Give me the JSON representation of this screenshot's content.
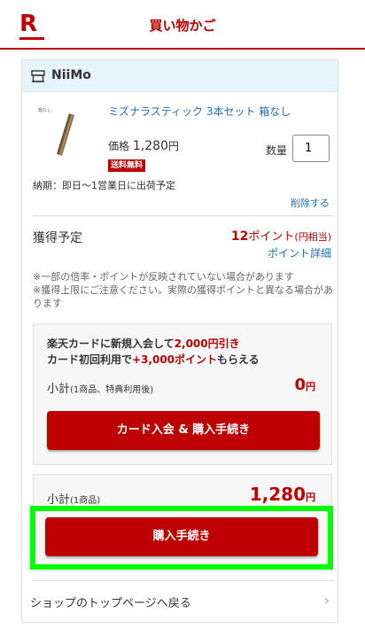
{
  "header": {
    "logo_letter": "R",
    "title": "買い物かご",
    "brand_color": "#bf0000"
  },
  "shop": {
    "icon": "shop-icon",
    "name": "NiiMo"
  },
  "item": {
    "image_caption": "箱なし",
    "name": "ミズナラスティック 3本セット 箱なし",
    "price_label": "価格",
    "price": "1,280",
    "price_unit": "円",
    "free_shipping": "送料無料",
    "quantity_label": "数量",
    "quantity": "1",
    "delivery": "納期：即日〜1営業日に出荷予定",
    "delete": "削除する"
  },
  "points": {
    "label": "獲得予定",
    "value": "12",
    "unit": "ポイント",
    "note": "(円相当)",
    "detail_link": "ポイント詳細",
    "notes": [
      "※一部の倍率・ポイントが反映されていない場合があります",
      "※獲得上限にご注意ください。実際の獲得ポイントと異なる場合があります"
    ]
  },
  "card_promo": {
    "line1_prefix": "楽天カードに新規入会して",
    "line1_highlight": "2,000円引き",
    "line2_prefix": "カード初回利用で",
    "line2_highlight": "+3,000ポイント",
    "line2_suffix": "もらえる",
    "subtotal_label": "小計",
    "subtotal_note": "(1商品、特典利用後)",
    "subtotal_value": "0",
    "subtotal_unit": "円",
    "button": "カード入会 & 購入手続き"
  },
  "total": {
    "label": "小計",
    "note": "(1商品)",
    "value": "1,280",
    "unit": "円",
    "button": "購入手続き"
  },
  "footer": {
    "back_link": "ショップのトップページへ戻る",
    "chevron": "chevron-right-icon"
  }
}
